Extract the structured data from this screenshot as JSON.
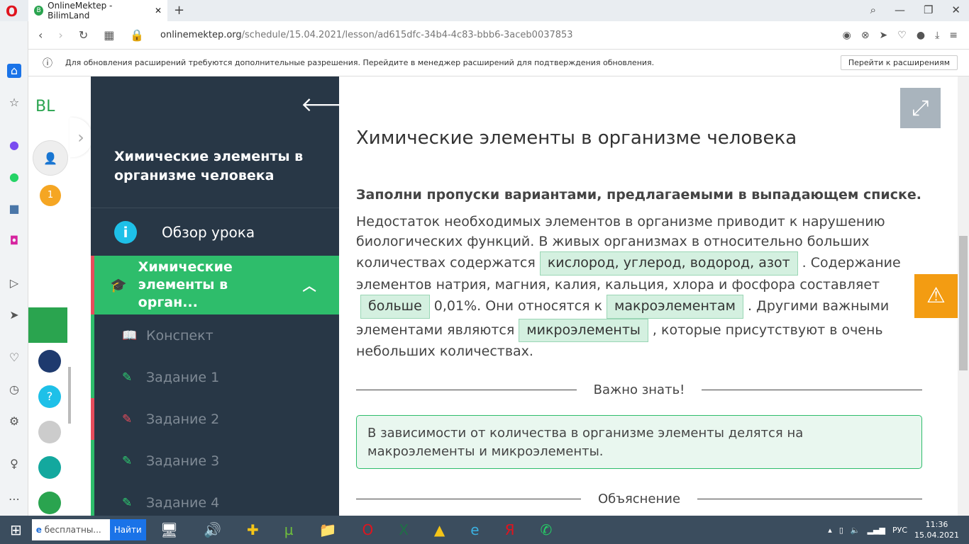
{
  "browser": {
    "tab_title": "OnlineMektep - BilimLand",
    "url_domain": "onlinemektep.org",
    "url_path": "/schedule/15.04.2021/lesson/ad615dfc-34b4-4c83-bbb6-3aceb0037853",
    "info_text": "Для обновления расширений требуются дополнительные разрешения. Перейдите в менеджер расширений для подтверждения обновления.",
    "info_button": "Перейти к расширениям"
  },
  "site": {
    "logo": "BL",
    "badge": "1"
  },
  "lesson": {
    "title": "Химические элементы в организме человека",
    "overview": "Обзор урока",
    "section": "Химические элементы в орган...",
    "items": [
      "Конспект",
      "Задание 1",
      "Задание 2",
      "Задание 3",
      "Задание 4"
    ]
  },
  "content": {
    "title": "Химические элементы в организме человека",
    "instruction": "Заполни пропуски вариантами, предлагаемыми в выпадающем списке.",
    "t1": "Недостаток необходимых элементов в организме приводит к нарушению биологических функций. В живых организмах в относительно больших количествах содержатся",
    "s1": "кислород, углерод, водород, азот",
    "t2": ". Содержание элементов натрия, магния, калия, кальция, хлора и фосфора составляет",
    "s2": "больше",
    "t3": "0,01%. Они относятся к",
    "s3": "макроэлементам",
    "t4": ". Другими важными элементами являются",
    "s4": "микроэлементы",
    "t5": ", которые присутствуют в очень небольших количествах.",
    "important_label": "Важно знать!",
    "important_text": "В зависимости от количества в организме элементы делятся на макроэлементы и микроэлементы.",
    "explanation_label": "Объяснение"
  },
  "taskbar": {
    "search": "бесплатны...",
    "search_btn": "Найти",
    "lang": "РУС",
    "time": "11:36",
    "date": "15.04.2021"
  }
}
